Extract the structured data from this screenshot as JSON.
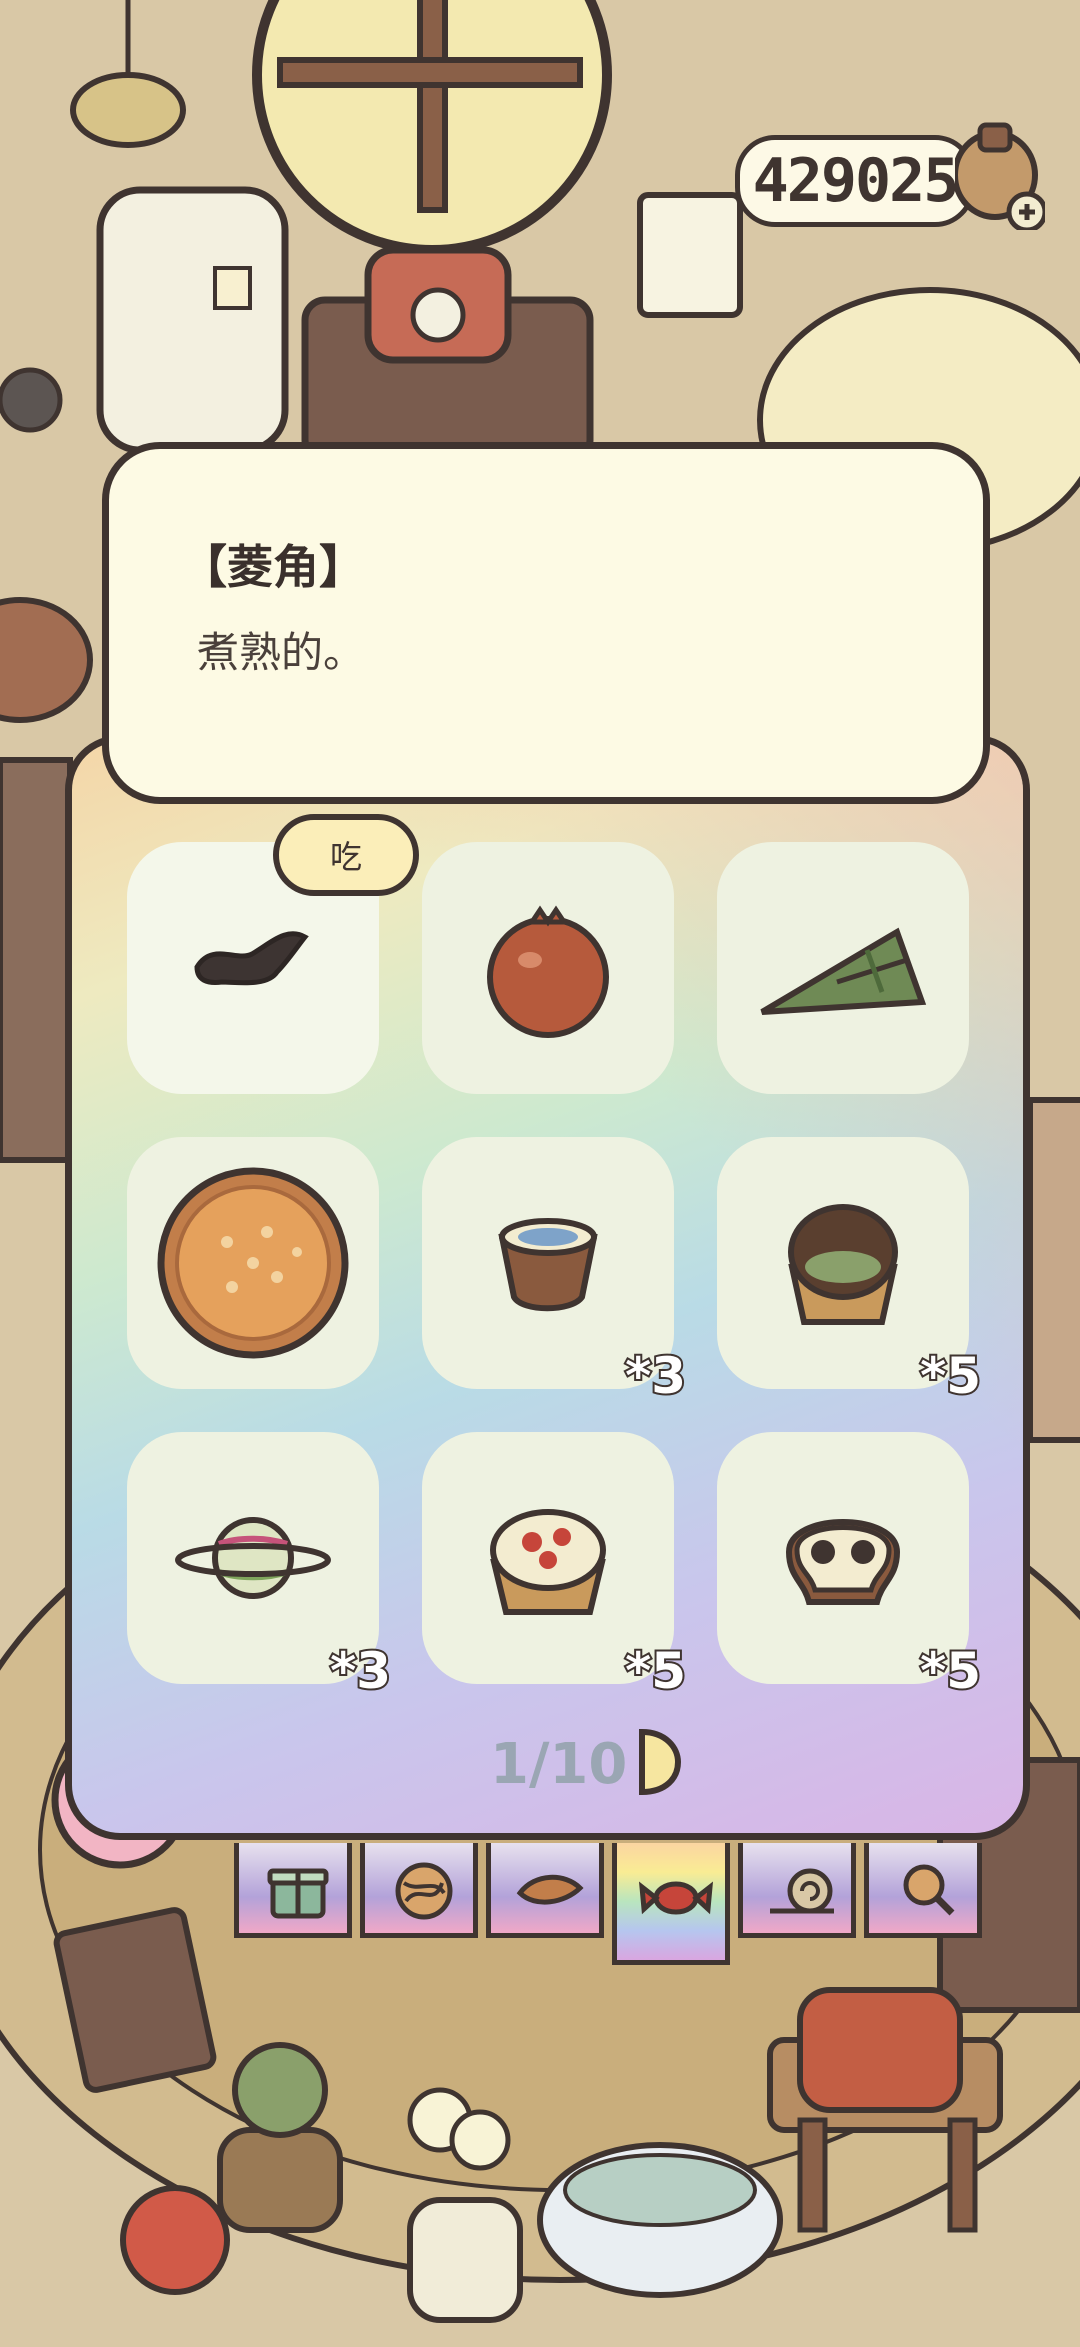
{
  "hud": {
    "currency_value": "429025",
    "add_icon": "plus-icon"
  },
  "item_info": {
    "title": "【菱角】",
    "description": "煮熟的。"
  },
  "inventory": {
    "action_button_label": "吃",
    "items": [
      {
        "icon": "water-caltrop-icon",
        "count": "",
        "selected": true
      },
      {
        "icon": "pomegranate-icon",
        "count": ""
      },
      {
        "icon": "zongzi-icon",
        "count": ""
      },
      {
        "icon": "pizza-icon",
        "count": ""
      },
      {
        "icon": "pudding-cup-icon",
        "count": "*3"
      },
      {
        "icon": "chocolate-cupcake-icon",
        "count": "*5"
      },
      {
        "icon": "planet-candy-icon",
        "count": "*3"
      },
      {
        "icon": "strawberry-tart-icon",
        "count": "*5"
      },
      {
        "icon": "skull-cookie-icon",
        "count": "*5"
      }
    ],
    "page_indicator": "1/10"
  },
  "tabs": [
    {
      "icon": "gift-icon",
      "active": false
    },
    {
      "icon": "yarn-ball-icon",
      "active": false
    },
    {
      "icon": "leaf-icon",
      "active": false
    },
    {
      "icon": "candy-icon",
      "active": true
    },
    {
      "icon": "snail-icon",
      "active": false
    },
    {
      "icon": "magnifier-icon",
      "active": false
    }
  ]
}
